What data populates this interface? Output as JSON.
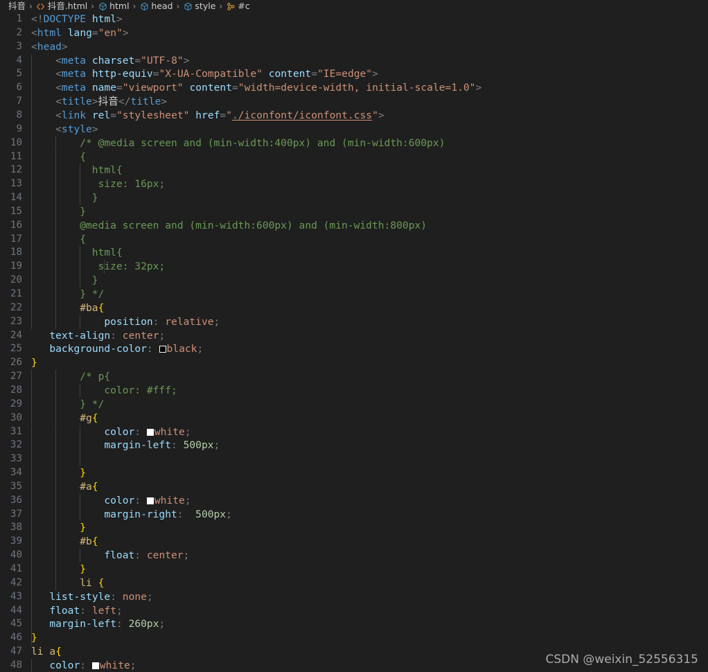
{
  "breadcrumb": {
    "items": [
      {
        "label": "抖音",
        "icon": "folder-icon",
        "truncated": true
      },
      {
        "label": "抖音.html",
        "icon": "html-file-icon"
      },
      {
        "label": "html",
        "icon": "symbol-cube-icon"
      },
      {
        "label": "head",
        "icon": "symbol-cube-icon"
      },
      {
        "label": "style",
        "icon": "symbol-cube-icon"
      },
      {
        "label": "#c",
        "icon": "css-selector-icon",
        "truncated": true
      }
    ],
    "separator": "›"
  },
  "editor": {
    "language": "html",
    "first_line": 1,
    "last_line": 48,
    "lines": [
      {
        "n": 1,
        "indent": 0,
        "guides": 0,
        "tokens": [
          {
            "c": "t-punct",
            "t": "<!"
          },
          {
            "c": "t-doctype",
            "t": "DOCTYPE"
          },
          {
            "c": "t-text",
            "t": " "
          },
          {
            "c": "t-doctype-name",
            "t": "html"
          },
          {
            "c": "t-punct",
            "t": ">"
          }
        ]
      },
      {
        "n": 2,
        "indent": 0,
        "guides": 0,
        "tokens": [
          {
            "c": "t-punct",
            "t": "<"
          },
          {
            "c": "t-tag",
            "t": "html"
          },
          {
            "c": "t-text",
            "t": " "
          },
          {
            "c": "t-attr",
            "t": "lang"
          },
          {
            "c": "t-punct",
            "t": "="
          },
          {
            "c": "t-str",
            "t": "\"en\""
          },
          {
            "c": "t-punct",
            "t": ">"
          }
        ]
      },
      {
        "n": 3,
        "indent": 0,
        "guides": 0,
        "tokens": [
          {
            "c": "t-punct",
            "t": "<"
          },
          {
            "c": "t-tag",
            "t": "head"
          },
          {
            "c": "t-punct",
            "t": ">"
          }
        ]
      },
      {
        "n": 4,
        "indent": 4,
        "guides": 1,
        "tokens": [
          {
            "c": "t-punct",
            "t": "<"
          },
          {
            "c": "t-tag",
            "t": "meta"
          },
          {
            "c": "t-text",
            "t": " "
          },
          {
            "c": "t-attr",
            "t": "charset"
          },
          {
            "c": "t-punct",
            "t": "="
          },
          {
            "c": "t-str",
            "t": "\"UTF-8\""
          },
          {
            "c": "t-punct",
            "t": ">"
          }
        ]
      },
      {
        "n": 5,
        "indent": 4,
        "guides": 1,
        "tokens": [
          {
            "c": "t-punct",
            "t": "<"
          },
          {
            "c": "t-tag",
            "t": "meta"
          },
          {
            "c": "t-text",
            "t": " "
          },
          {
            "c": "t-attr",
            "t": "http-equiv"
          },
          {
            "c": "t-punct",
            "t": "="
          },
          {
            "c": "t-str",
            "t": "\"X-UA-Compatible\""
          },
          {
            "c": "t-text",
            "t": " "
          },
          {
            "c": "t-attr",
            "t": "content"
          },
          {
            "c": "t-punct",
            "t": "="
          },
          {
            "c": "t-str",
            "t": "\"IE=edge\""
          },
          {
            "c": "t-punct",
            "t": ">"
          }
        ]
      },
      {
        "n": 6,
        "indent": 4,
        "guides": 1,
        "tokens": [
          {
            "c": "t-punct",
            "t": "<"
          },
          {
            "c": "t-tag",
            "t": "meta"
          },
          {
            "c": "t-text",
            "t": " "
          },
          {
            "c": "t-attr",
            "t": "name"
          },
          {
            "c": "t-punct",
            "t": "="
          },
          {
            "c": "t-str",
            "t": "\"viewport\""
          },
          {
            "c": "t-text",
            "t": " "
          },
          {
            "c": "t-attr",
            "t": "content"
          },
          {
            "c": "t-punct",
            "t": "="
          },
          {
            "c": "t-str",
            "t": "\"width=device-width, initial-scale=1.0\""
          },
          {
            "c": "t-punct",
            "t": ">"
          }
        ]
      },
      {
        "n": 7,
        "indent": 4,
        "guides": 1,
        "tokens": [
          {
            "c": "t-punct",
            "t": "<"
          },
          {
            "c": "t-tag",
            "t": "title"
          },
          {
            "c": "t-punct",
            "t": ">"
          },
          {
            "c": "t-text",
            "t": "抖音"
          },
          {
            "c": "t-punct",
            "t": "</"
          },
          {
            "c": "t-tag",
            "t": "title"
          },
          {
            "c": "t-punct",
            "t": ">"
          }
        ]
      },
      {
        "n": 8,
        "indent": 4,
        "guides": 1,
        "tokens": [
          {
            "c": "t-punct",
            "t": "<"
          },
          {
            "c": "t-tag",
            "t": "link"
          },
          {
            "c": "t-text",
            "t": " "
          },
          {
            "c": "t-attr",
            "t": "rel"
          },
          {
            "c": "t-punct",
            "t": "="
          },
          {
            "c": "t-str",
            "t": "\"stylesheet\""
          },
          {
            "c": "t-text",
            "t": " "
          },
          {
            "c": "t-attr",
            "t": "href"
          },
          {
            "c": "t-punct",
            "t": "="
          },
          {
            "c": "t-str",
            "t": "\""
          },
          {
            "c": "t-strlink",
            "t": "./iconfont/iconfont.css"
          },
          {
            "c": "t-str",
            "t": "\""
          },
          {
            "c": "t-punct",
            "t": ">"
          }
        ]
      },
      {
        "n": 9,
        "indent": 4,
        "guides": 1,
        "tokens": [
          {
            "c": "t-punct",
            "t": "<"
          },
          {
            "c": "t-tag",
            "t": "style"
          },
          {
            "c": "t-punct",
            "t": ">"
          }
        ]
      },
      {
        "n": 10,
        "indent": 8,
        "guides": 2,
        "tokens": [
          {
            "c": "t-comment",
            "t": "/* @media screen and (min-width:400px) and (min-width:600px)"
          }
        ]
      },
      {
        "n": 11,
        "indent": 8,
        "guides": 2,
        "tokens": [
          {
            "c": "t-comment",
            "t": "{"
          }
        ]
      },
      {
        "n": 12,
        "indent": 10,
        "guides": 3,
        "tokens": [
          {
            "c": "t-comment",
            "t": "html{"
          }
        ]
      },
      {
        "n": 13,
        "indent": 11,
        "guides": 3,
        "tokens": [
          {
            "c": "t-comment",
            "t": "size: 16px;"
          }
        ]
      },
      {
        "n": 14,
        "indent": 10,
        "guides": 3,
        "tokens": [
          {
            "c": "t-comment",
            "t": "}"
          }
        ]
      },
      {
        "n": 15,
        "indent": 8,
        "guides": 2,
        "tokens": [
          {
            "c": "t-comment",
            "t": "}"
          }
        ]
      },
      {
        "n": 16,
        "indent": 8,
        "guides": 2,
        "tokens": [
          {
            "c": "t-comment",
            "t": "@media screen and (min-width:600px) and (min-width:800px)"
          }
        ]
      },
      {
        "n": 17,
        "indent": 8,
        "guides": 2,
        "tokens": [
          {
            "c": "t-comment",
            "t": "{"
          }
        ]
      },
      {
        "n": 18,
        "indent": 10,
        "guides": 3,
        "tokens": [
          {
            "c": "t-comment",
            "t": "html{"
          }
        ]
      },
      {
        "n": 19,
        "indent": 11,
        "guides": 4,
        "tokens": [
          {
            "c": "t-comment",
            "t": "size: 32px;"
          }
        ]
      },
      {
        "n": 20,
        "indent": 10,
        "guides": 3,
        "tokens": [
          {
            "c": "t-comment",
            "t": "}"
          }
        ]
      },
      {
        "n": 21,
        "indent": 8,
        "guides": 2,
        "tokens": [
          {
            "c": "t-comment",
            "t": "} */"
          }
        ]
      },
      {
        "n": 22,
        "indent": 8,
        "guides": 2,
        "tokens": [
          {
            "c": "t-sel",
            "t": "#ba"
          },
          {
            "c": "t-brace",
            "t": "{"
          }
        ]
      },
      {
        "n": 23,
        "indent": 12,
        "guides": 3,
        "tokens": [
          {
            "c": "t-prop",
            "t": "position"
          },
          {
            "c": "t-punct",
            "t": ": "
          },
          {
            "c": "t-val",
            "t": "relative"
          },
          {
            "c": "t-punct",
            "t": ";"
          }
        ]
      },
      {
        "n": 24,
        "indent": 3,
        "guides": 0,
        "tokens": [
          {
            "c": "t-prop",
            "t": "text-align"
          },
          {
            "c": "t-punct",
            "t": ": "
          },
          {
            "c": "t-val",
            "t": "center"
          },
          {
            "c": "t-punct",
            "t": ";"
          }
        ]
      },
      {
        "n": 25,
        "indent": 3,
        "guides": 0,
        "tokens": [
          {
            "c": "t-prop",
            "t": "background-color"
          },
          {
            "c": "t-punct",
            "t": ": "
          },
          {
            "c": "swatch-black",
            "t": "@swatch"
          },
          {
            "c": "t-val",
            "t": "black"
          },
          {
            "c": "t-punct",
            "t": ";"
          }
        ]
      },
      {
        "n": 26,
        "indent": 0,
        "guides": 0,
        "tokens": [
          {
            "c": "t-brace",
            "t": "}"
          }
        ]
      },
      {
        "n": 27,
        "indent": 8,
        "guides": 2,
        "tokens": [
          {
            "c": "t-comment",
            "t": "/* p{"
          }
        ]
      },
      {
        "n": 28,
        "indent": 12,
        "guides": 3,
        "tokens": [
          {
            "c": "t-comment",
            "t": "color: #fff;"
          }
        ]
      },
      {
        "n": 29,
        "indent": 8,
        "guides": 2,
        "tokens": [
          {
            "c": "t-comment",
            "t": "} */"
          }
        ]
      },
      {
        "n": 30,
        "indent": 8,
        "guides": 2,
        "tokens": [
          {
            "c": "t-sel",
            "t": "#g"
          },
          {
            "c": "t-brace",
            "t": "{"
          }
        ]
      },
      {
        "n": 31,
        "indent": 12,
        "guides": 3,
        "tokens": [
          {
            "c": "t-prop",
            "t": "color"
          },
          {
            "c": "t-punct",
            "t": ": "
          },
          {
            "c": "swatch-white",
            "t": "@swatch"
          },
          {
            "c": "t-val",
            "t": "white"
          },
          {
            "c": "t-punct",
            "t": ";"
          }
        ]
      },
      {
        "n": 32,
        "indent": 12,
        "guides": 3,
        "tokens": [
          {
            "c": "t-prop",
            "t": "margin-left"
          },
          {
            "c": "t-punct",
            "t": ": "
          },
          {
            "c": "t-num",
            "t": "500px"
          },
          {
            "c": "t-punct",
            "t": ";"
          }
        ]
      },
      {
        "n": 33,
        "indent": 0,
        "guides": 3,
        "tokens": []
      },
      {
        "n": 34,
        "indent": 8,
        "guides": 2,
        "tokens": [
          {
            "c": "t-brace",
            "t": "}"
          }
        ]
      },
      {
        "n": 35,
        "indent": 8,
        "guides": 2,
        "tokens": [
          {
            "c": "t-sel",
            "t": "#a"
          },
          {
            "c": "t-brace",
            "t": "{"
          }
        ]
      },
      {
        "n": 36,
        "indent": 12,
        "guides": 3,
        "tokens": [
          {
            "c": "t-prop",
            "t": "color"
          },
          {
            "c": "t-punct",
            "t": ": "
          },
          {
            "c": "swatch-white",
            "t": "@swatch"
          },
          {
            "c": "t-val",
            "t": "white"
          },
          {
            "c": "t-punct",
            "t": ";"
          }
        ]
      },
      {
        "n": 37,
        "indent": 12,
        "guides": 3,
        "tokens": [
          {
            "c": "t-prop",
            "t": "margin-right"
          },
          {
            "c": "t-punct",
            "t": ":  "
          },
          {
            "c": "t-num",
            "t": "500px"
          },
          {
            "c": "t-punct",
            "t": ";"
          }
        ]
      },
      {
        "n": 38,
        "indent": 8,
        "guides": 2,
        "tokens": [
          {
            "c": "t-brace",
            "t": "}"
          }
        ]
      },
      {
        "n": 39,
        "indent": 8,
        "guides": 2,
        "tokens": [
          {
            "c": "t-sel",
            "t": "#b"
          },
          {
            "c": "t-brace",
            "t": "{"
          }
        ]
      },
      {
        "n": 40,
        "indent": 12,
        "guides": 3,
        "tokens": [
          {
            "c": "t-prop",
            "t": "float"
          },
          {
            "c": "t-punct",
            "t": ": "
          },
          {
            "c": "t-val",
            "t": "center"
          },
          {
            "c": "t-punct",
            "t": ";"
          }
        ]
      },
      {
        "n": 41,
        "indent": 8,
        "guides": 2,
        "tokens": [
          {
            "c": "t-brace",
            "t": "}"
          }
        ]
      },
      {
        "n": 42,
        "indent": 8,
        "guides": 2,
        "tokens": [
          {
            "c": "t-sel",
            "t": "li "
          },
          {
            "c": "t-brace",
            "t": "{"
          }
        ]
      },
      {
        "n": 43,
        "indent": 3,
        "guides": 1,
        "tokens": [
          {
            "c": "t-prop",
            "t": "list-style"
          },
          {
            "c": "t-punct",
            "t": ": "
          },
          {
            "c": "t-val",
            "t": "none"
          },
          {
            "c": "t-punct",
            "t": ";"
          }
        ]
      },
      {
        "n": 44,
        "indent": 3,
        "guides": 1,
        "tokens": [
          {
            "c": "t-prop",
            "t": "float"
          },
          {
            "c": "t-punct",
            "t": ": "
          },
          {
            "c": "t-val",
            "t": "left"
          },
          {
            "c": "t-punct",
            "t": ";"
          }
        ]
      },
      {
        "n": 45,
        "indent": 3,
        "guides": 1,
        "tokens": [
          {
            "c": "t-prop",
            "t": "margin-left"
          },
          {
            "c": "t-punct",
            "t": ": "
          },
          {
            "c": "t-num",
            "t": "260px"
          },
          {
            "c": "t-punct",
            "t": ";"
          }
        ]
      },
      {
        "n": 46,
        "indent": 0,
        "guides": 1,
        "tokens": [
          {
            "c": "t-brace",
            "t": "}"
          }
        ]
      },
      {
        "n": 47,
        "indent": 0,
        "guides": 0,
        "tokens": [
          {
            "c": "t-sel",
            "t": "li a"
          },
          {
            "c": "t-brace",
            "t": "{"
          }
        ]
      },
      {
        "n": 48,
        "indent": 3,
        "guides": 1,
        "tokens": [
          {
            "c": "t-prop",
            "t": "color"
          },
          {
            "c": "t-punct",
            "t": ": "
          },
          {
            "c": "swatch-white",
            "t": "@swatch"
          },
          {
            "c": "t-val",
            "t": "white"
          },
          {
            "c": "t-punct",
            "t": ";"
          }
        ]
      }
    ]
  },
  "watermark": {
    "text": "CSDN @weixin_52556315"
  },
  "colors": {
    "background": "#1f1f1f",
    "line_number": "#6e7681",
    "tag": "#569cd6",
    "attribute": "#9cdcfe",
    "string": "#ce9178",
    "comment": "#6a9955",
    "selector": "#d7ba7d",
    "brace": "#ffd700",
    "number": "#b5cea8",
    "indent_guide": "#404040"
  }
}
